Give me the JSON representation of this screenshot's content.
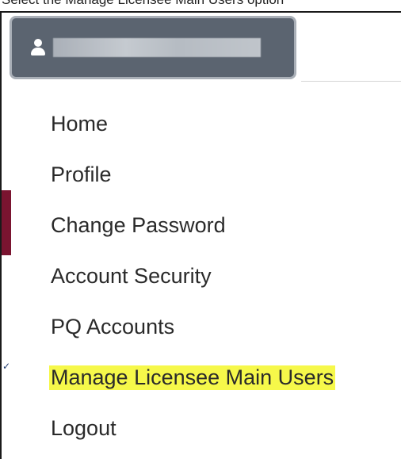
{
  "caption": {
    "text": "Select the Manage Licensee Main Users option"
  },
  "user_menu": {
    "user_icon": "user-icon",
    "user_name": ""
  },
  "menu": {
    "items": [
      {
        "label": "Home"
      },
      {
        "label": "Profile"
      },
      {
        "label": "Change Password"
      },
      {
        "label": "Account Security"
      },
      {
        "label": "PQ Accounts"
      },
      {
        "label": "Manage Licensee Main Users",
        "highlighted": true,
        "highlight_color": "#f6f84a"
      },
      {
        "label": "Logout"
      }
    ]
  },
  "colors": {
    "button_bg": "#5b6470",
    "button_border": "#a9afb7",
    "accent": "#7a1430",
    "highlight": "#f6f84a"
  }
}
